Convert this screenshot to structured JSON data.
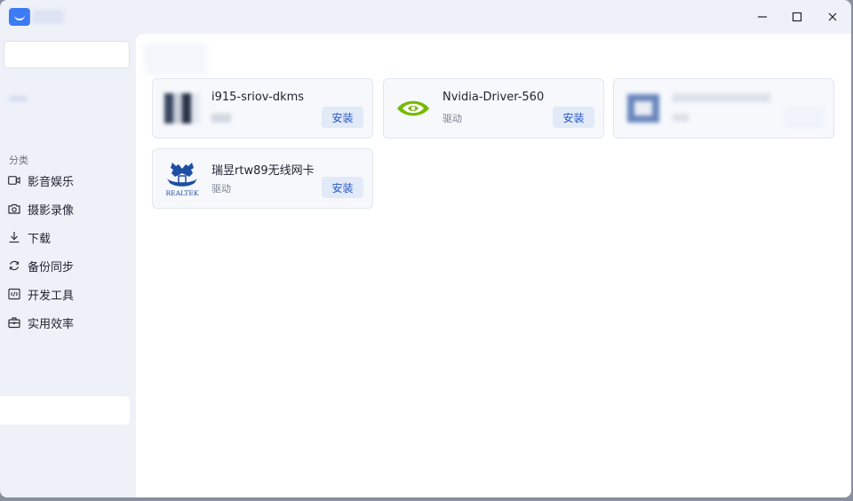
{
  "window": {
    "controls": {
      "minimize": "minimize-icon",
      "maximize": "maximize-icon",
      "close": "close-icon"
    }
  },
  "sidebar": {
    "category_title": "分类",
    "items": [
      {
        "label": "影音娱乐",
        "icon": "video-icon"
      },
      {
        "label": "摄影录像",
        "icon": "camera-icon"
      },
      {
        "label": "下载",
        "icon": "download-icon"
      },
      {
        "label": "备份同步",
        "icon": "sync-icon"
      },
      {
        "label": "开发工具",
        "icon": "code-icon"
      },
      {
        "label": "实用效率",
        "icon": "toolbox-icon"
      }
    ]
  },
  "main": {
    "cards": [
      {
        "name": "i915-sriov-dkms",
        "type": "",
        "install_label": "安装"
      },
      {
        "name": "Nvidia-Driver-560",
        "type": "驱动",
        "install_label": "安装"
      },
      {
        "name": "",
        "type": "",
        "install_label": ""
      },
      {
        "name": "瑞昱rtw89无线网卡",
        "type": "驱动",
        "install_label": "安装",
        "logo_text": "REALTEK"
      }
    ]
  },
  "colors": {
    "accent": "#2456c8",
    "button_bg": "#e2eaf8",
    "nvidia_green": "#76b900",
    "realtek_blue": "#1e4fa3"
  }
}
